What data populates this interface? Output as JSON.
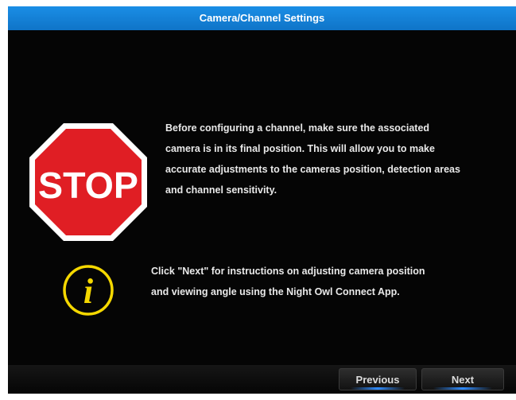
{
  "window": {
    "title": "Camera/Channel Settings"
  },
  "icons": {
    "stop_sign": "stop-sign-icon",
    "stop_label": "STOP",
    "info": "info-icon",
    "info_glyph": "i"
  },
  "colors": {
    "title_bar": "#1a8ee6",
    "background": "#050505",
    "stop_red": "#e01e24",
    "info_yellow": "#f5d800",
    "button_underline": "#2f8cff"
  },
  "content": {
    "warning_text": "Before configuring a channel, make sure the associated\ncamera is in its final position. This will allow you to make\naccurate adjustments to the cameras position, detection areas\nand channel sensitivity.",
    "info_text": "Click \"Next\" for instructions on adjusting camera position\nand viewing angle using the Night Owl Connect App."
  },
  "buttons": {
    "previous_label": "Previous",
    "next_label": "Next"
  }
}
